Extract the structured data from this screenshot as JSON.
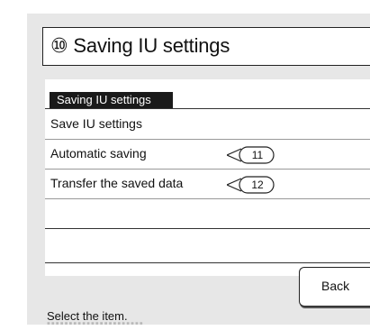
{
  "header": {
    "title": "⑩ Saving IU settings"
  },
  "section": {
    "tab_label": "Saving IU settings"
  },
  "menu": {
    "items": [
      {
        "label": "Save IU settings",
        "callout": ""
      },
      {
        "label": "Automatic saving",
        "callout": "11"
      },
      {
        "label": "Transfer the saved data",
        "callout": "12"
      }
    ]
  },
  "footer": {
    "back_label": "Back",
    "status_text": "Select the item."
  }
}
